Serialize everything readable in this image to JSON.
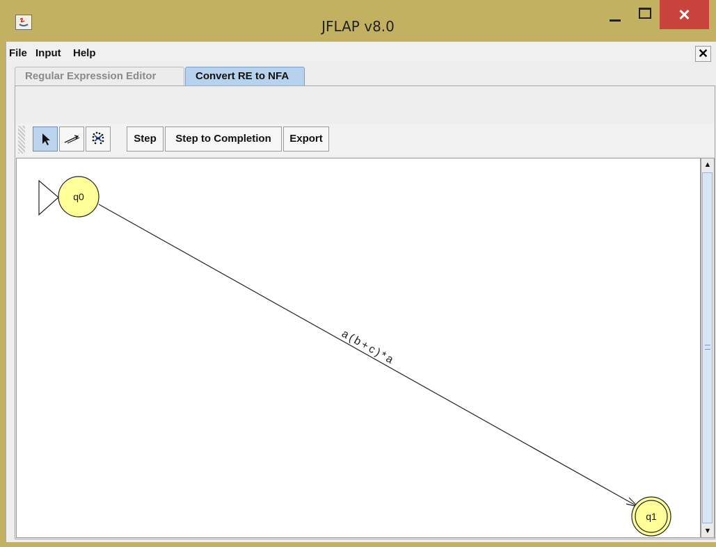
{
  "window": {
    "title": "JFLAP v8.0",
    "close_label": "✕"
  },
  "menu": {
    "file": "File",
    "input": "Input",
    "help": "Help",
    "close_doc": "✕"
  },
  "tabs": [
    {
      "label": "Regular Expression Editor"
    },
    {
      "label": "Convert RE to NFA"
    }
  ],
  "toolbar": {
    "step": "Step",
    "step_to_completion": "Step to Completion",
    "export": "Export"
  },
  "automaton": {
    "states": [
      {
        "label": "q0",
        "initial": true
      },
      {
        "label": "q1",
        "final": true
      }
    ],
    "transition": {
      "from": "q0",
      "to": "q1",
      "label": "a(b+c)*a"
    }
  },
  "colors": {
    "state_fill": "#ffff99",
    "selected_tool": "#bcd4ee",
    "title_bar": "#c2b160",
    "close_button": "#c7433b"
  },
  "icons": [
    "java-app-icon",
    "pointer-icon",
    "transition-arrow-icon",
    "delete-dots-icon"
  ]
}
